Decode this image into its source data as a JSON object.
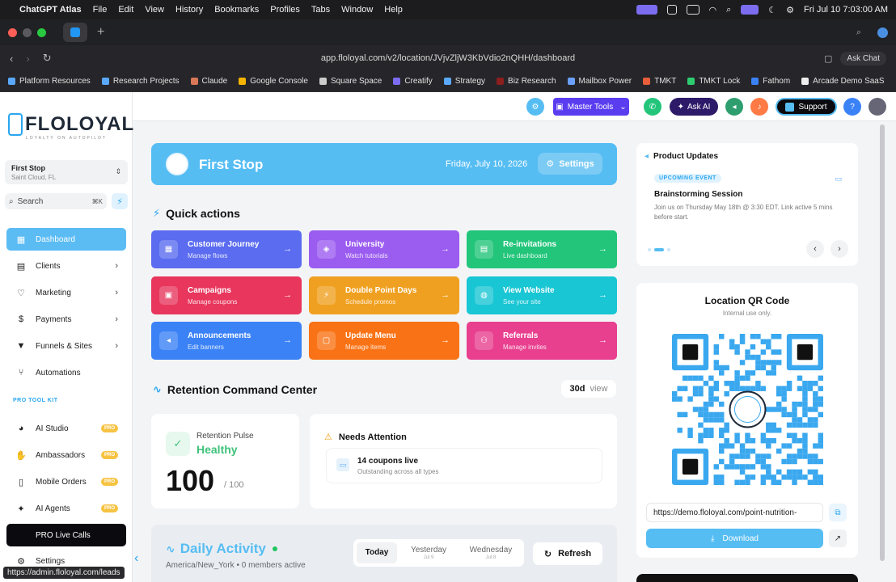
{
  "menubar": {
    "app": "ChatGPT Atlas",
    "items": [
      "File",
      "Edit",
      "View",
      "History",
      "Bookmarks",
      "Profiles",
      "Tabs",
      "Window",
      "Help"
    ],
    "datetime": "Fri Jul 10  7:03:00 AM"
  },
  "browser": {
    "url": "app.floloyal.com/v2/location/JVjvZljW3KbVdio2nQHH/dashboard",
    "ask_chat": "Ask Chat",
    "bookmarks": [
      "Platform Resources",
      "Research Projects",
      "Claude",
      "Google Console",
      "Square Space",
      "Creatify",
      "Strategy",
      "Biz Research",
      "Mailbox Power",
      "TMKT",
      "TMKT Lock",
      "Fathom",
      "Arcade Demo SaaS"
    ],
    "status_url": "https://admin.floloyal.com/leads"
  },
  "sidebar": {
    "logo": "FLOLOYAL",
    "tagline": "LOYALTY ON AUTOPILOT",
    "location_name": "First Stop",
    "location_city": "Saint Cloud, FL",
    "search_placeholder": "Search",
    "search_shortcut": "⌘K",
    "section_label": "PRO TOOL KIT",
    "items": [
      {
        "label": "Dashboard"
      },
      {
        "label": "Clients"
      },
      {
        "label": "Marketing"
      },
      {
        "label": "Payments"
      },
      {
        "label": "Funnels & Sites"
      },
      {
        "label": "Automations"
      },
      {
        "label": "AI Studio",
        "badge": "PRO"
      },
      {
        "label": "Ambassadors",
        "badge": "PRO"
      },
      {
        "label": "Mobile Orders",
        "badge": "PRO"
      },
      {
        "label": "AI Agents",
        "badge": "PRO"
      },
      {
        "label": "PRO Live Calls"
      },
      {
        "label": "Settings"
      }
    ]
  },
  "topbar": {
    "master_tools": "Master Tools",
    "ask_ai": "Ask AI",
    "support": "Support",
    "help": "?"
  },
  "banner": {
    "title": "First Stop",
    "date": "Friday, July 10, 2026",
    "settings": "Settings"
  },
  "quick_actions": {
    "heading": "Quick actions",
    "items": [
      {
        "title": "Customer Journey",
        "sub": "Manage flows",
        "color": "#5b6cf0"
      },
      {
        "title": "University",
        "sub": "Watch tutorials",
        "color": "#9b5cf0"
      },
      {
        "title": "Re-invitations",
        "sub": "Live dashboard",
        "color": "#22c57a"
      },
      {
        "title": "Campaigns",
        "sub": "Manage coupons",
        "color": "#e8365d"
      },
      {
        "title": "Double Point Days",
        "sub": "Schedule promos",
        "color": "#f0a020"
      },
      {
        "title": "View Website",
        "sub": "See your site",
        "color": "#19c6d4"
      },
      {
        "title": "Announcements",
        "sub": "Edit banners",
        "color": "#3b82f6"
      },
      {
        "title": "Update Menu",
        "sub": "Manage items",
        "color": "#f97316"
      },
      {
        "title": "Referrals",
        "sub": "Manage invites",
        "color": "#e8408f"
      }
    ]
  },
  "retention": {
    "heading": "Retention Command Center",
    "range": "30d",
    "view": "view",
    "pulse_label": "Retention Pulse",
    "pulse_status": "Healthy",
    "score": "100",
    "score_max": "/ 100",
    "needs_attention": "Needs Attention",
    "coupons_title": "14 coupons live",
    "coupons_sub": "Outstanding across all types"
  },
  "daily": {
    "title": "Daily Activity",
    "timezone": "America/New_York",
    "members": "0 members active",
    "tabs": [
      {
        "label": "Today",
        "sub": ""
      },
      {
        "label": "Yesterday",
        "sub": "Jul 9"
      },
      {
        "label": "Wednesday",
        "sub": "Jul 8"
      }
    ],
    "refresh": "Refresh"
  },
  "product_updates": {
    "title": "Product Updates",
    "badge": "UPCOMING EVENT",
    "event": "Brainstorming Session",
    "desc": "Join us on Thursday May 18th @ 3:30 EDT. Link active 5 mins before start."
  },
  "qr": {
    "title": "Location QR Code",
    "sub": "Internal use only.",
    "url": "https://demo.floloyal.com/point-nutrition-",
    "download": "Download"
  }
}
